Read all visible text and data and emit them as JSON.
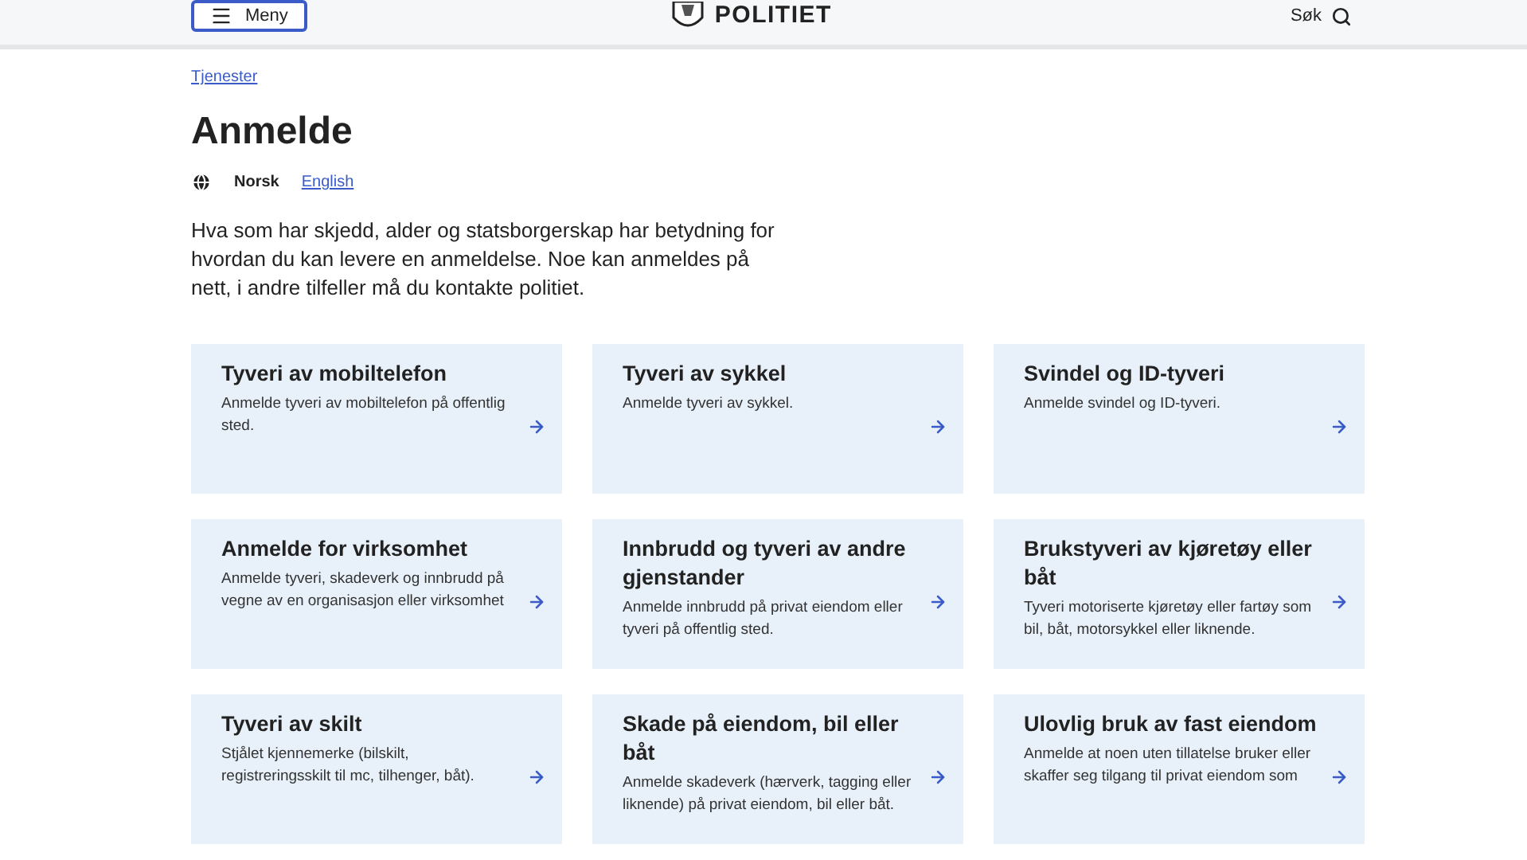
{
  "header": {
    "menu_button": "Meny",
    "logo": "POLITIET",
    "search": "Søk"
  },
  "breadcrumb": "Tjenester",
  "title": "Anmelde",
  "languages": [
    {
      "label": "Norsk",
      "selected": true
    },
    {
      "label": "English",
      "selected": false
    }
  ],
  "intro": "Hva som har skjedd, alder og statsborgerskap har betydning for hvordan du kan levere en anmeldelse. Noe kan anmeldes på nett, i andre tilfeller må du kontakte politiet.",
  "cards": [
    {
      "title": "Tyveri av mobiltelefon",
      "description": "Anmelde tyveri av mobiltelefon på offentlig sted."
    },
    {
      "title": "Tyveri av sykkel",
      "description": "Anmelde tyveri av sykkel."
    },
    {
      "title": "Svindel og ID-tyveri",
      "description": "Anmelde svindel og ID-tyveri."
    },
    {
      "title": "Anmelde for virksomhet",
      "description": "Anmelde tyveri, skadeverk og innbrudd på vegne av en organisasjon eller virksomhet"
    },
    {
      "title": "Innbrudd og tyveri av andre gjenstander",
      "description": "Anmelde innbrudd på privat eiendom eller tyveri på offentlig sted."
    },
    {
      "title": "Brukstyveri av kjøretøy eller båt",
      "description": "Tyveri motoriserte kjøretøy eller fartøy som bil, båt, motorsykkel eller liknende."
    },
    {
      "title": "Tyveri av skilt",
      "description": "Stjålet kjennemerke (bilskilt, registreringsskilt til mc, tilhenger, båt)."
    },
    {
      "title": "Skade på eiendom, bil eller båt",
      "description": "Anmelde skadeverk (hærverk, tagging eller liknende) på privat eiendom, bil eller båt."
    },
    {
      "title": "Ulovlig bruk av fast eiendom",
      "description": "Anmelde at noen uten tillatelse bruker eller skaffer seg tilgang til privat eiendom som"
    }
  ]
}
